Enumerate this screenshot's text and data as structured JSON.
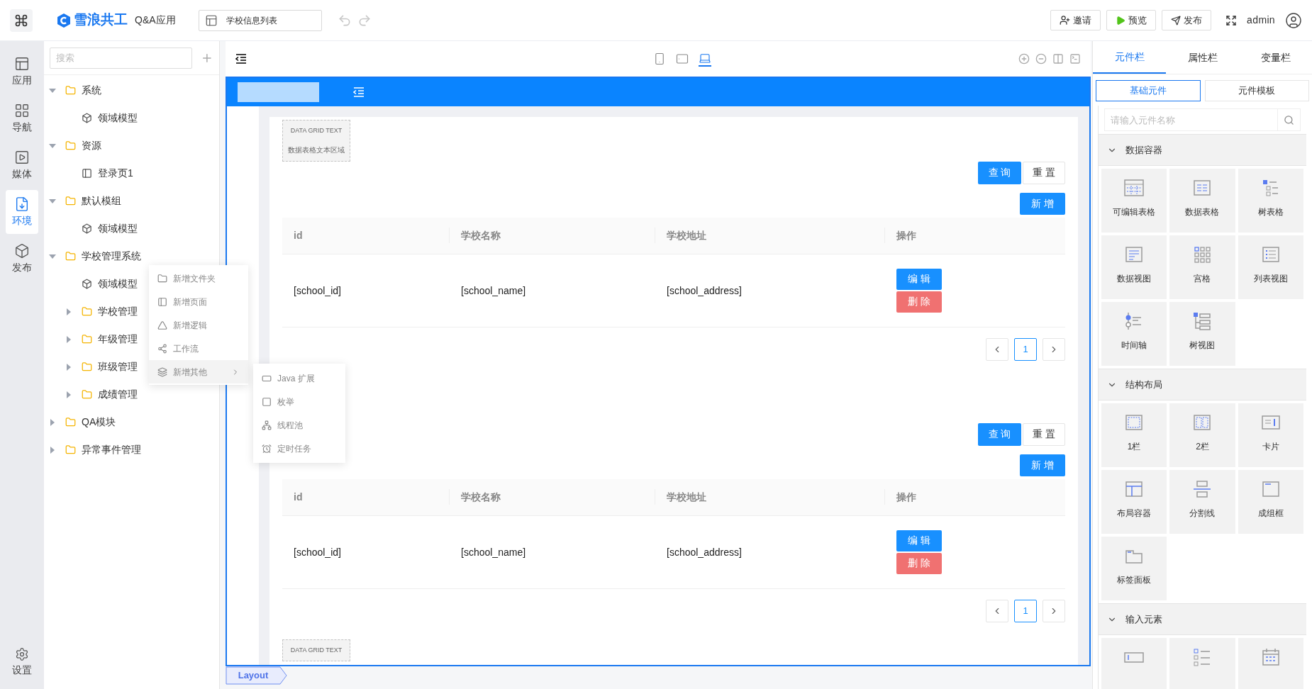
{
  "topbar": {
    "brand": "雪浪共工",
    "app": "Q&A应用",
    "page_select": "学校信息列表",
    "buttons": [
      {
        "label": "邀请",
        "kind": "invite"
      },
      {
        "label": "预览",
        "kind": "preview"
      },
      {
        "label": "发布",
        "kind": "publish"
      }
    ],
    "user": "admin"
  },
  "rail": {
    "items": [
      {
        "label": "应用",
        "kind": "app",
        "selected": false
      },
      {
        "label": "导航",
        "kind": "nav",
        "selected": false
      },
      {
        "label": "媒体",
        "kind": "media",
        "selected": false
      },
      {
        "label": "环境",
        "kind": "env",
        "selected": true
      },
      {
        "label": "发布",
        "kind": "publish",
        "selected": false
      }
    ],
    "settings": "设置"
  },
  "tree": {
    "search_placeholder": "搜索",
    "items": [
      {
        "label": "系统",
        "kind": "folder",
        "expanded": true,
        "children": [
          {
            "label": "领域模型",
            "kind": "model"
          }
        ]
      },
      {
        "label": "资源",
        "kind": "folder",
        "expanded": true,
        "children": [
          {
            "label": "登录页1",
            "kind": "page"
          }
        ]
      },
      {
        "label": "默认模组",
        "kind": "folder",
        "expanded": true,
        "children": [
          {
            "label": "领域模型",
            "kind": "model"
          }
        ]
      },
      {
        "label": "学校管理系统",
        "kind": "folder",
        "expanded": true,
        "children": [
          {
            "label": "领域模型",
            "kind": "model"
          },
          {
            "label": "学校管理",
            "kind": "folder",
            "expanded": false
          },
          {
            "label": "年级管理",
            "kind": "folder",
            "expanded": false
          },
          {
            "label": "班级管理",
            "kind": "folder",
            "expanded": false
          },
          {
            "label": "成绩管理",
            "kind": "folder",
            "expanded": false
          }
        ]
      },
      {
        "label": "QA模块",
        "kind": "folder",
        "expanded": false
      },
      {
        "label": "异常事件管理",
        "kind": "folder",
        "expanded": false
      }
    ]
  },
  "context_menu": {
    "items": [
      {
        "label": "新增文件夹",
        "kind": "folder",
        "selected": false
      },
      {
        "label": "新增页面",
        "kind": "page",
        "selected": false
      },
      {
        "label": "新增逻辑",
        "kind": "logic",
        "selected": false
      },
      {
        "label": "工作流",
        "kind": "workflow",
        "selected": false
      },
      {
        "label": "新增其他",
        "kind": "other",
        "selected": true
      }
    ]
  },
  "submenu": {
    "items": [
      {
        "label": "Java 扩展",
        "kind": "java"
      },
      {
        "label": "枚举",
        "kind": "enum"
      },
      {
        "label": "线程池",
        "kind": "pool"
      },
      {
        "label": "定时任务",
        "kind": "timer"
      }
    ]
  },
  "canvas_toolbar": {
    "devices": [
      {
        "kind": "phone",
        "selected": false
      },
      {
        "kind": "tablet",
        "selected": false
      },
      {
        "kind": "desktop",
        "selected": true
      }
    ]
  },
  "canvas": {
    "grid_text": "DATA GRID TEXT",
    "grid_subtext": "数据表格文本区域",
    "blocks": [
      {
        "query": "查 询",
        "reset": "重 置",
        "add": "新 增",
        "columns": [
          "id",
          "学校名称",
          "学校地址",
          "操作"
        ],
        "row": [
          "[school_id]",
          "[school_name]",
          "[school_address]"
        ],
        "edit": "编 辑",
        "delete": "删 除",
        "page": "1"
      },
      {
        "query": "查 询",
        "reset": "重 置",
        "add": "新 增",
        "columns": [
          "id",
          "学校名称",
          "学校地址",
          "操作"
        ],
        "row": [
          "[school_id]",
          "[school_name]",
          "[school_address]"
        ],
        "edit": "编 辑",
        "delete": "删 除",
        "page": "1"
      }
    ],
    "footer_grid_text": "DATA GRID TEXT"
  },
  "breadcrumb": "Layout",
  "right_panel": {
    "tabs": [
      {
        "label": "元件栏",
        "selected": true
      },
      {
        "label": "属性栏",
        "selected": false
      },
      {
        "label": "变量栏",
        "selected": false
      }
    ],
    "subtabs": [
      {
        "label": "基础元件",
        "selected": true
      },
      {
        "label": "元件模板",
        "selected": false
      }
    ],
    "search_placeholder": "请输入元件名称",
    "sections": [
      {
        "title": "数据容器",
        "expanded": true,
        "items": [
          {
            "label": "可编辑表格",
            "kind": "editable-table"
          },
          {
            "label": "数据表格",
            "kind": "data-table"
          },
          {
            "label": "树表格",
            "kind": "tree-table"
          },
          {
            "label": "数据视图",
            "kind": "data-view"
          },
          {
            "label": "宫格",
            "kind": "grid"
          },
          {
            "label": "列表视图",
            "kind": "list-view"
          },
          {
            "label": "时间轴",
            "kind": "timeline"
          },
          {
            "label": "树视图",
            "kind": "tree-view"
          }
        ]
      },
      {
        "title": "结构布局",
        "expanded": true,
        "items": [
          {
            "label": "1栏",
            "kind": "one-col"
          },
          {
            "label": "2栏",
            "kind": "two-col"
          },
          {
            "label": "卡片",
            "kind": "card"
          },
          {
            "label": "布局容器",
            "kind": "layout"
          },
          {
            "label": "分割线",
            "kind": "divider"
          },
          {
            "label": "成组框",
            "kind": "group"
          },
          {
            "label": "标签面板",
            "kind": "tabs"
          }
        ]
      },
      {
        "title": "输入元素",
        "expanded": true,
        "items": [
          {
            "kind": "input"
          },
          {
            "kind": "checklist"
          },
          {
            "kind": "calendar"
          }
        ]
      }
    ]
  }
}
